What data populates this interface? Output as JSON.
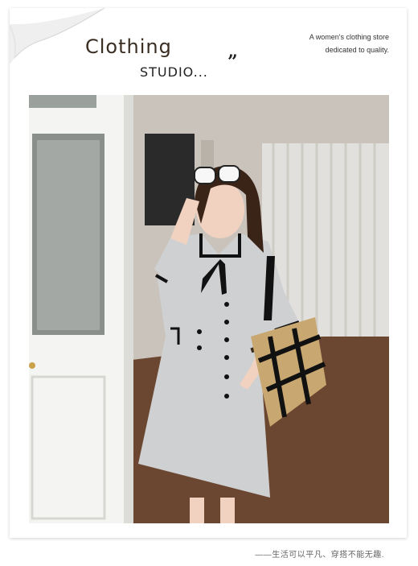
{
  "header": {
    "title": "Clothing",
    "subtitle": "STUDIO...",
    "quote_mark": "”",
    "tagline_line1": "A women's clothing store",
    "tagline_line2": "dedicated to quality."
  },
  "footer": {
    "note": "——生活可以平凡、穿搭不能无趣."
  },
  "colors": {
    "title": "#3a2d22",
    "dress": "#cfd0d2",
    "dress_trim": "#111111",
    "floor": "#6b4630",
    "wall": "#c9c3bb",
    "door": "#f4f4f2",
    "curtain": "#e2e0dc",
    "bag": "#c8a771"
  }
}
